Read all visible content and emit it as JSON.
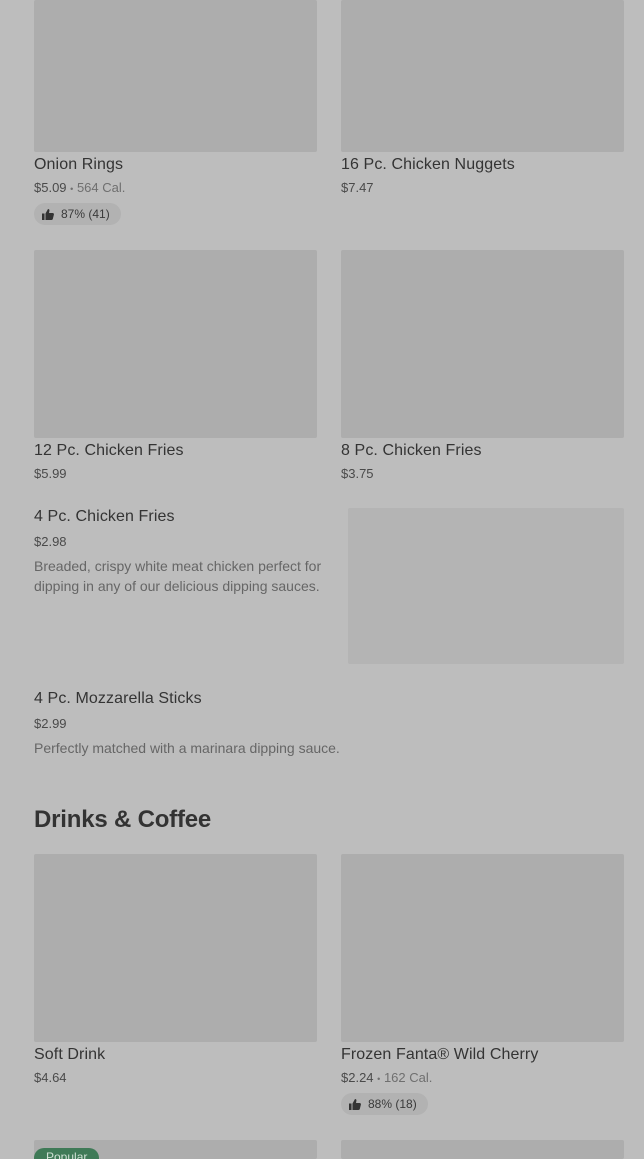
{
  "items": [
    {
      "title": "Onion Rings",
      "price": "$5.09",
      "cal": "564 Cal.",
      "rating": "87% (41)"
    },
    {
      "title": "16 Pc. Chicken Nuggets",
      "price": "$7.47"
    },
    {
      "title": "12 Pc. Chicken Fries",
      "price": "$5.99"
    },
    {
      "title": "8 Pc. Chicken Fries",
      "price": "$3.75"
    },
    {
      "title": "4 Pc. Chicken Fries",
      "price": "$2.98",
      "desc": "Breaded, crispy white meat chicken perfect for dipping in any of our delicious dipping sauces."
    },
    {
      "title": "4 Pc. Mozzarella Sticks",
      "price": "$2.99",
      "desc": "Perfectly matched with a marinara dipping sauce."
    },
    {
      "title": "Soft Drink",
      "price": "$4.64"
    },
    {
      "title": "Frozen Fanta® Wild Cherry",
      "price": "$2.24",
      "cal": "162 Cal.",
      "rating": "88% (18)"
    }
  ],
  "section": {
    "drinks_title": "Drinks & Coffee"
  },
  "badge": {
    "label": "Popular"
  },
  "separator": "•",
  "icons": {
    "rating": "thumbs-up-icon"
  },
  "colors": {
    "background": "#bdbdbd",
    "placeholder": "#adadad",
    "badge": "#3f7a57"
  }
}
